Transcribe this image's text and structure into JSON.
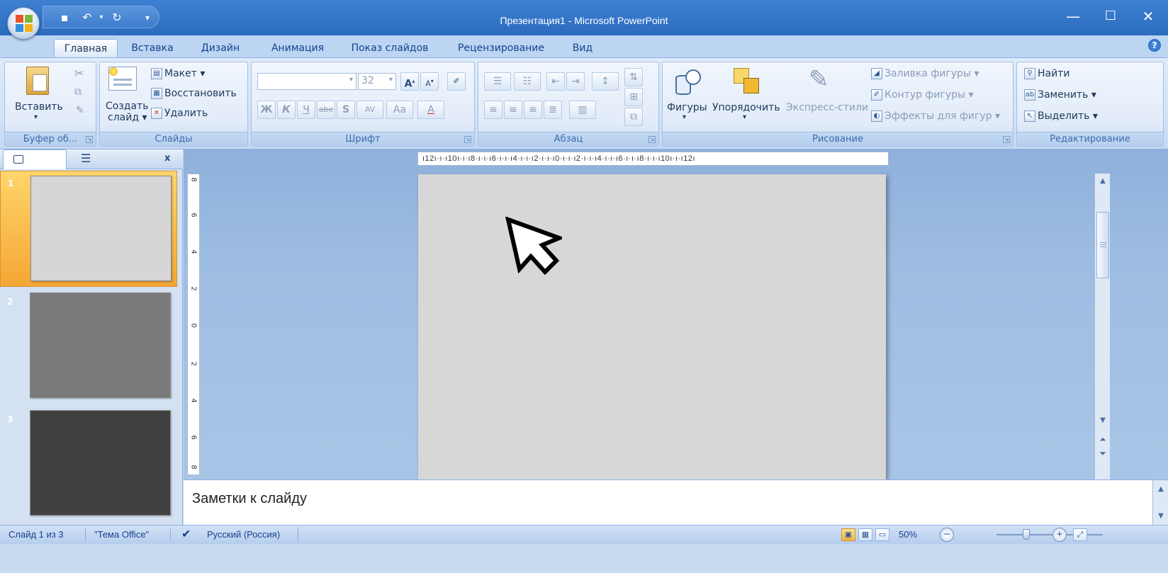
{
  "window": {
    "title": "Презентация1 - Microsoft PowerPoint",
    "minimize": "—",
    "maximize": "☐",
    "close": "✕"
  },
  "tabs": [
    {
      "label": "Главная",
      "active": true
    },
    {
      "label": "Вставка"
    },
    {
      "label": "Дизайн"
    },
    {
      "label": "Анимация"
    },
    {
      "label": "Показ слайдов"
    },
    {
      "label": "Рецензирование"
    },
    {
      "label": "Вид"
    }
  ],
  "ribbon": {
    "clipboard": {
      "label": "Буфер об...",
      "paste": "Вставить"
    },
    "slides": {
      "label": "Слайды",
      "new_slide_line1": "Создать",
      "new_slide_line2": "слайд",
      "layout": "Макет",
      "reset": "Восстановить",
      "delete": "Удалить"
    },
    "font": {
      "label": "Шрифт",
      "size": "32",
      "bold": "Ж",
      "italic": "К",
      "underline": "Ч",
      "strike": "abe",
      "shadow": "S",
      "spacing": "AV",
      "case": "Aa",
      "color": "A"
    },
    "paragraph": {
      "label": "Абзац"
    },
    "drawing": {
      "label": "Рисование",
      "shapes": "Фигуры",
      "arrange": "Упорядочить",
      "quick_styles": "Экспресс-стили",
      "fill": "Заливка фигуры",
      "outline": "Контур фигуры",
      "effects": "Эффекты для фигур"
    },
    "editing": {
      "label": "Редактирование",
      "find": "Найти",
      "replace": "Заменить",
      "select": "Выделить"
    }
  },
  "slides_pane": {
    "close": "x",
    "slides": [
      {
        "number": "1",
        "color": "#d6d6d6",
        "selected": true
      },
      {
        "number": "2",
        "color": "#7a7a7a"
      },
      {
        "number": "3",
        "color": "#404040"
      }
    ]
  },
  "ruler": {
    "horizontal": "ı12ı·ı·ı10ı·ı·ı8·ı·ı·ı6·ı·ı·ı4·ı·ı·ı2·ı·ı·ı0·ı·ı·ı2·ı·ı·ı4·ı·ı·ı6·ı·ı·ı8·ı·ı·ı10ı·ı·ı12ı",
    "vertical": [
      "8",
      "6",
      "4",
      "2",
      "0",
      "2",
      "4",
      "6",
      "8"
    ]
  },
  "notes": {
    "placeholder": "Заметки к слайду"
  },
  "status": {
    "slide_info": "Слайд 1 из 3",
    "theme": "\"Тема Office\"",
    "language": "Русский (Россия)",
    "zoom": "50%"
  },
  "colors": {
    "accent": "#2b6cbf",
    "selected_thumb": "#f4a634"
  }
}
